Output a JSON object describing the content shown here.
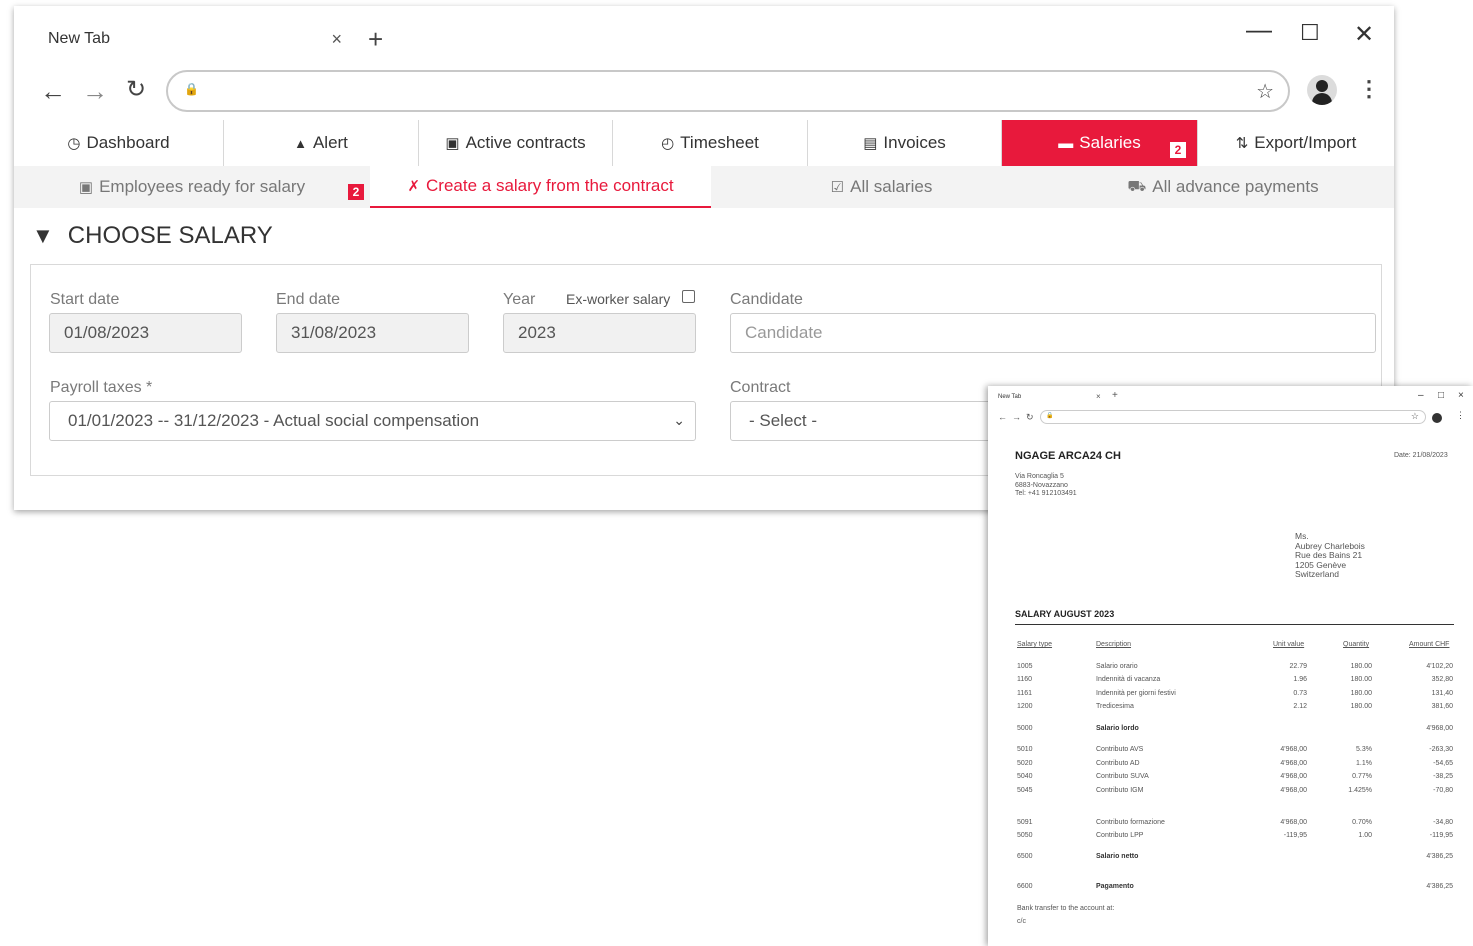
{
  "browser": {
    "tab_title": "New Tab",
    "tab_close": "×",
    "new_tab": "+",
    "min": "—",
    "max": "☐",
    "close": "✕"
  },
  "main_nav": [
    {
      "label": "Dashboard",
      "icon": "dashboard-icon",
      "glyph": "◷"
    },
    {
      "label": "Alert",
      "icon": "bell-icon",
      "glyph": "🔔"
    },
    {
      "label": "Active contracts",
      "icon": "briefcase-icon",
      "glyph": "▣"
    },
    {
      "label": "Timesheet",
      "icon": "clock-icon",
      "glyph": "◴"
    },
    {
      "label": "Invoices",
      "icon": "invoice-icon",
      "glyph": "▤"
    },
    {
      "label": "Salaries",
      "icon": "money-icon",
      "glyph": "▬",
      "badge": "2",
      "active": true
    },
    {
      "label": "Export/Import",
      "icon": "sort-icon",
      "glyph": "⇅"
    }
  ],
  "sub_nav": [
    {
      "label": "Employees ready for salary",
      "glyph": "▣",
      "badge": "2"
    },
    {
      "label": "Create a salary from the contract",
      "glyph": "✗",
      "active": true
    },
    {
      "label": "All salaries",
      "glyph": "☑"
    },
    {
      "label": "All advance payments",
      "glyph": "⛟"
    }
  ],
  "section": {
    "title": "CHOOSE SALARY",
    "funnel": "▼"
  },
  "form": {
    "start_date_label": "Start date",
    "start_date_value": "01/08/2023",
    "end_date_label": "End date",
    "end_date_value": "31/08/2023",
    "year_label": "Year",
    "year_value": "2023",
    "ex_worker_label": "Ex-worker salary",
    "candidate_label": "Candidate",
    "candidate_placeholder": "Candidate",
    "payroll_label": "Payroll taxes *",
    "payroll_value": "01/01/2023 -- 31/12/2023 - Actual social compensation",
    "contract_label": "Contract",
    "contract_value": "- Select -"
  },
  "slip": {
    "tab_title": "New Tab",
    "company": "NGAGE ARCA24 CH",
    "date": "Date: 21/08/2023",
    "address": [
      "Via Roncaglia 5",
      "6883-Novazzano",
      "Tel: +41 912103491"
    ],
    "recipient": [
      "Ms.",
      "Aubrey Charlebois",
      "Rue des Bains 21",
      "1205 Genève",
      "Switzerland"
    ],
    "title": "SALARY AUGUST 2023",
    "headers": [
      "Salary type",
      "Description",
      "Unit value",
      "Quantity",
      "Amount CHF"
    ],
    "rows": [
      {
        "type": "1005",
        "desc": "Salario orario",
        "unit": "22.79",
        "qty": "180.00",
        "amount": "4'102,20"
      },
      {
        "type": "1160",
        "desc": "Indennità di vacanza",
        "unit": "1.96",
        "qty": "180.00",
        "amount": "352,80"
      },
      {
        "type": "1161",
        "desc": "Indennità per giorni festivi",
        "unit": "0.73",
        "qty": "180.00",
        "amount": "131,40"
      },
      {
        "type": "1200",
        "desc": "Tredicesima",
        "unit": "2.12",
        "qty": "180.00",
        "amount": "381,60"
      },
      {
        "type": "5000",
        "desc": "Salario lordo",
        "unit": "",
        "qty": "",
        "amount": "4'968,00",
        "bold": true
      },
      {
        "type": "5010",
        "desc": "Contributo AVS",
        "unit": "4'968,00",
        "qty": "5.3%",
        "amount": "-263,30"
      },
      {
        "type": "5020",
        "desc": "Contributo AD",
        "unit": "4'968,00",
        "qty": "1.1%",
        "amount": "-54,65"
      },
      {
        "type": "5040",
        "desc": "Contributo SUVA",
        "unit": "4'968,00",
        "qty": "0.77%",
        "amount": "-38,25"
      },
      {
        "type": "5045",
        "desc": "Contributo IGM",
        "unit": "4'968,00",
        "qty": "1.425%",
        "amount": "-70,80"
      },
      {
        "type": "5091",
        "desc": "Contributo formazione",
        "unit": "4'968,00",
        "qty": "0.70%",
        "amount": "-34,80"
      },
      {
        "type": "5050",
        "desc": "Contributo LPP",
        "unit": "-119,95",
        "qty": "1.00",
        "amount": "-119,95"
      },
      {
        "type": "6500",
        "desc": "Salario netto",
        "unit": "",
        "qty": "",
        "amount": "4'386,25",
        "bold": true
      },
      {
        "type": "6600",
        "desc": "Pagamento",
        "unit": "",
        "qty": "",
        "amount": "4'386,25",
        "bold": true
      }
    ],
    "footer": [
      "Bank transfer to the account at:",
      "c/c"
    ]
  },
  "colors": {
    "accent": "#e8193c"
  }
}
